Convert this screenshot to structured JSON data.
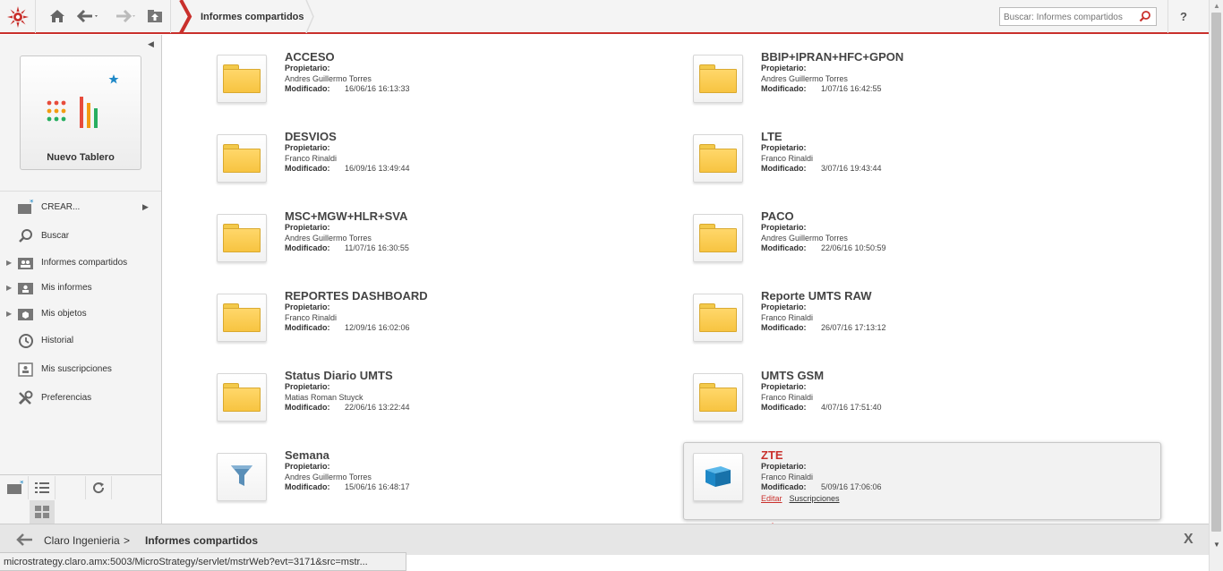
{
  "topbar": {
    "title": "Informes compartidos",
    "search_placeholder": "Buscar: Informes compartidos",
    "help_label": "?"
  },
  "sidebar": {
    "new_tile_label": "Nuevo Tablero",
    "items": [
      {
        "label": "CREAR...",
        "icon": "create-icon"
      },
      {
        "label": "Buscar",
        "icon": "search-icon"
      },
      {
        "label": "Informes compartidos",
        "icon": "shared-reports-icon"
      },
      {
        "label": "Mis informes",
        "icon": "my-reports-icon"
      },
      {
        "label": "Mis objetos",
        "icon": "my-objects-icon"
      },
      {
        "label": "Historial",
        "icon": "history-icon"
      },
      {
        "label": "Mis suscripciones",
        "icon": "subscriptions-icon"
      },
      {
        "label": "Preferencias",
        "icon": "preferences-icon"
      }
    ]
  },
  "labels": {
    "owner": "Propietario:",
    "modified": "Modificado:",
    "edit": "Editar",
    "subscriptions": "Suscripciones"
  },
  "items": [
    {
      "name": "ACCESO",
      "owner": "Andres Guillermo Torres",
      "modified": "16/06/16 16:13:33",
      "type": "folder"
    },
    {
      "name": "BBIP+IPRAN+HFC+GPON",
      "owner": "Andres Guillermo Torres",
      "modified": "1/07/16 16:42:55",
      "type": "folder"
    },
    {
      "name": "DESVIOS",
      "owner": "Franco Rinaldi",
      "modified": "16/09/16 13:49:44",
      "type": "folder"
    },
    {
      "name": "LTE",
      "owner": "Franco Rinaldi",
      "modified": "3/07/16 19:43:44",
      "type": "folder"
    },
    {
      "name": "MSC+MGW+HLR+SVA",
      "owner": "Andres Guillermo Torres",
      "modified": "11/07/16 16:30:55",
      "type": "folder"
    },
    {
      "name": "PACO",
      "owner": "Andres Guillermo Torres",
      "modified": "22/06/16 10:50:59",
      "type": "folder"
    },
    {
      "name": "REPORTES DASHBOARD",
      "owner": "Franco Rinaldi",
      "modified": "12/09/16 16:02:06",
      "type": "folder"
    },
    {
      "name": "Reporte UMTS RAW",
      "owner": "Franco Rinaldi",
      "modified": "26/07/16 17:13:12",
      "type": "folder"
    },
    {
      "name": "Status Diario UMTS",
      "owner": "Matias Roman Stuyck",
      "modified": "22/06/16 13:22:44",
      "type": "folder"
    },
    {
      "name": "UMTS GSM",
      "owner": "Franco Rinaldi",
      "modified": "4/07/16 17:51:40",
      "type": "folder"
    },
    {
      "name": "Semana",
      "owner": "Andres Guillermo Torres",
      "modified": "15/06/16 16:48:17",
      "type": "filter"
    },
    {
      "name": "ZTE",
      "owner": "Franco Rinaldi",
      "modified": "5/09/16 17:06:06",
      "type": "cube",
      "selected": true
    }
  ],
  "breadcrumb": {
    "parent": "Claro Ingenieria",
    "separator": ">",
    "current": "Informes compartidos",
    "close": "X"
  },
  "status": {
    "url": "microstrategy.claro.amx:5003/MicroStrategy/servlet/mstrWeb?evt=3171&src=mstr..."
  },
  "colors": {
    "accent": "#c9302c",
    "folder": "#f7c441",
    "cube": "#1e88c7"
  }
}
